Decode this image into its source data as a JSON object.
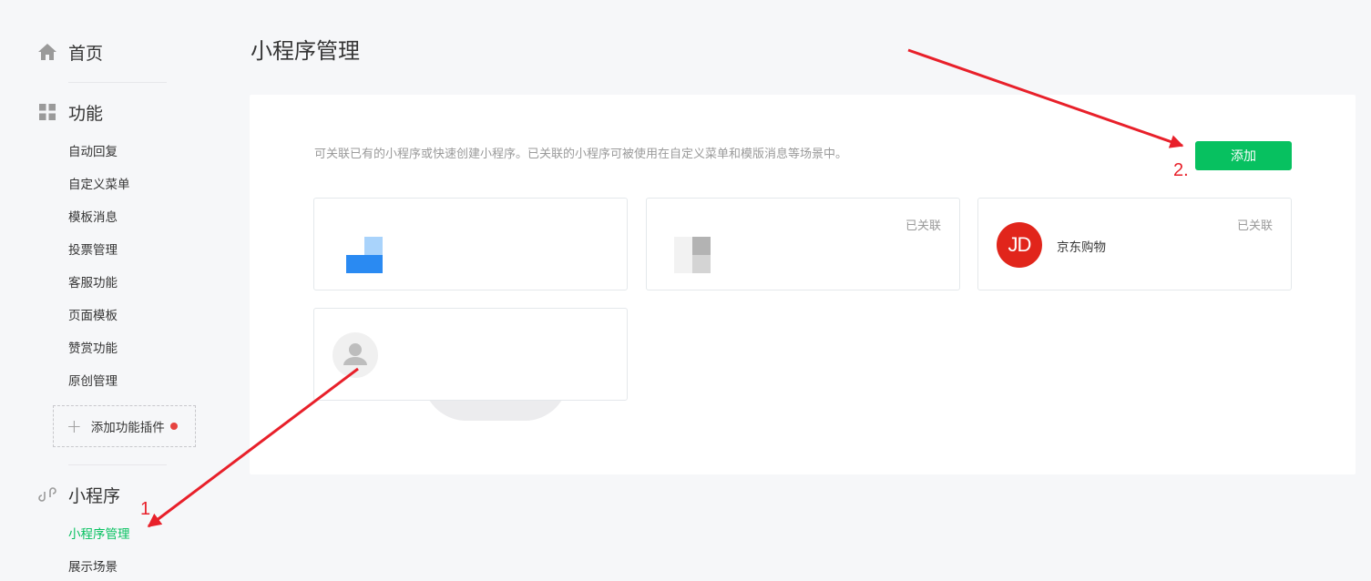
{
  "sidebar": {
    "home_label": "首页",
    "feature_label": "功能",
    "feature_items": [
      "自动回复",
      "自定义菜单",
      "模板消息",
      "投票管理",
      "客服功能",
      "页面模板",
      "赞赏功能",
      "原创管理"
    ],
    "plugin_label": "添加功能插件",
    "miniprogram_label": "小程序",
    "miniprogram_items": [
      "小程序管理",
      "展示场景"
    ],
    "active_item": "小程序管理"
  },
  "main": {
    "title": "小程序管理",
    "description": "可关联已有的小程序或快速创建小程序。已关联的小程序可被使用在自定义菜单和模版消息等场景中。",
    "add_label": "添加",
    "cards": [
      {
        "name": "",
        "status": ""
      },
      {
        "name": "",
        "status": "已关联"
      },
      {
        "name": "京东购物",
        "status": "已关联",
        "logo_text": "JD"
      },
      {
        "name": "",
        "status": ""
      }
    ]
  },
  "annotations": {
    "step1": "1",
    "step2": "2."
  },
  "colors": {
    "accent": "#07c160",
    "annotation": "#e8202a",
    "jd_brand": "#e1251b",
    "badge_dot": "#e64340"
  }
}
